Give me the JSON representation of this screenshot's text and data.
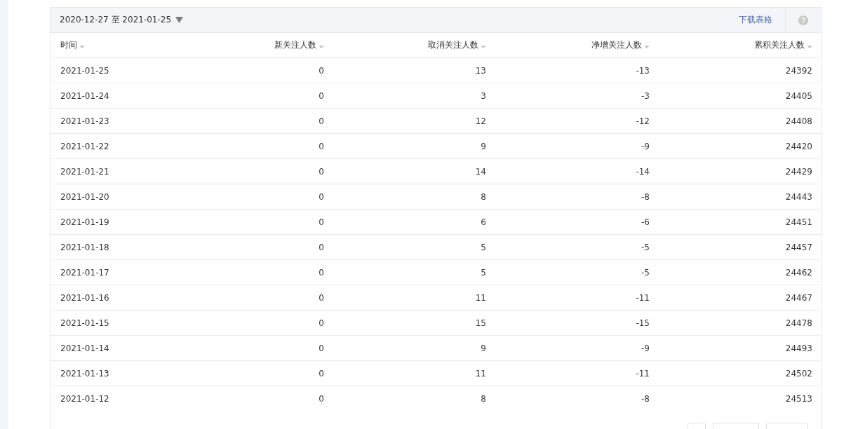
{
  "toolbar": {
    "date_range": "2020-12-27 至 2021-01-25",
    "download_link": "下载表格"
  },
  "table": {
    "columns": [
      "时间",
      "新关注人数",
      "取消关注人数",
      "净增关注人数",
      "累积关注人数"
    ],
    "rows": [
      [
        "2021-01-25",
        "0",
        "13",
        "-13",
        "24392"
      ],
      [
        "2021-01-24",
        "0",
        "3",
        "-3",
        "24405"
      ],
      [
        "2021-01-23",
        "0",
        "12",
        "-12",
        "24408"
      ],
      [
        "2021-01-22",
        "0",
        "9",
        "-9",
        "24420"
      ],
      [
        "2021-01-21",
        "0",
        "14",
        "-14",
        "24429"
      ],
      [
        "2021-01-20",
        "0",
        "8",
        "-8",
        "24443"
      ],
      [
        "2021-01-19",
        "0",
        "6",
        "-6",
        "24451"
      ],
      [
        "2021-01-18",
        "0",
        "5",
        "-5",
        "24457"
      ],
      [
        "2021-01-17",
        "0",
        "5",
        "-5",
        "24462"
      ],
      [
        "2021-01-16",
        "0",
        "11",
        "-11",
        "24467"
      ],
      [
        "2021-01-15",
        "0",
        "15",
        "-15",
        "24478"
      ],
      [
        "2021-01-14",
        "0",
        "9",
        "-9",
        "24493"
      ],
      [
        "2021-01-13",
        "0",
        "11",
        "-11",
        "24502"
      ],
      [
        "2021-01-12",
        "0",
        "8",
        "-8",
        "24513"
      ]
    ]
  }
}
